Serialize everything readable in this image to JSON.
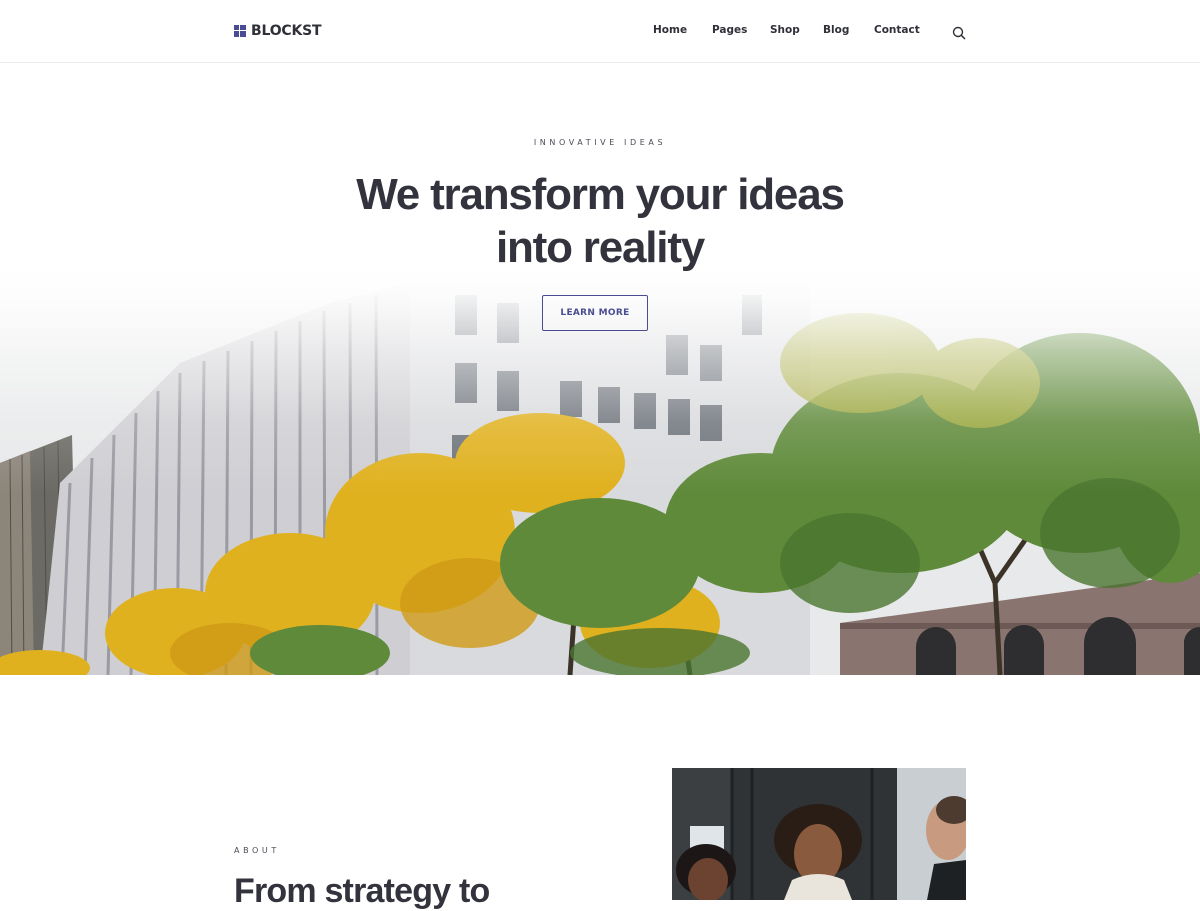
{
  "brand": {
    "name": "BLOCKST",
    "accent": "#4a4d93",
    "text_color": "#2f3038"
  },
  "nav": {
    "items": [
      {
        "label": "Home"
      },
      {
        "label": "Pages"
      },
      {
        "label": "Shop"
      },
      {
        "label": "Blog"
      },
      {
        "label": "Contact"
      }
    ],
    "search_icon": "search-icon"
  },
  "hero": {
    "eyebrow": "INNOVATIVE IDEAS",
    "title_line1": "We transform your ideas",
    "title_line2": "into reality",
    "cta_label": "LEARN MORE",
    "image": "city-building-with-autumn-trees"
  },
  "about": {
    "eyebrow": "ABOUT",
    "title": "From strategy to",
    "image": "team-meeting-smiling-people"
  }
}
